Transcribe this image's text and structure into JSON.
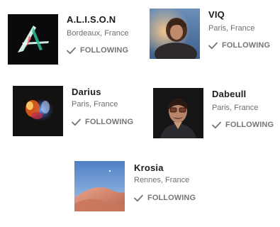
{
  "artists": [
    {
      "name": "A.L.I.S.O.N",
      "location": "Bordeaux, France",
      "follow_label": "FOLLOWING"
    },
    {
      "name": "VIQ",
      "location": "Paris, France",
      "follow_label": "FOLLOWING"
    },
    {
      "name": "Darius",
      "location": "Paris, France",
      "follow_label": "FOLLOWING"
    },
    {
      "name": "Dabeull",
      "location": "Paris, France",
      "follow_label": "FOLLOWING"
    },
    {
      "name": "Krosia",
      "location": "Rennes, France",
      "follow_label": "FOLLOWING"
    }
  ],
  "icons": {
    "follow_status": "checkmark-icon"
  },
  "colors": {
    "name_text": "#1c1c1c",
    "meta_text": "#6e6e6e",
    "follow_text": "#767676"
  }
}
